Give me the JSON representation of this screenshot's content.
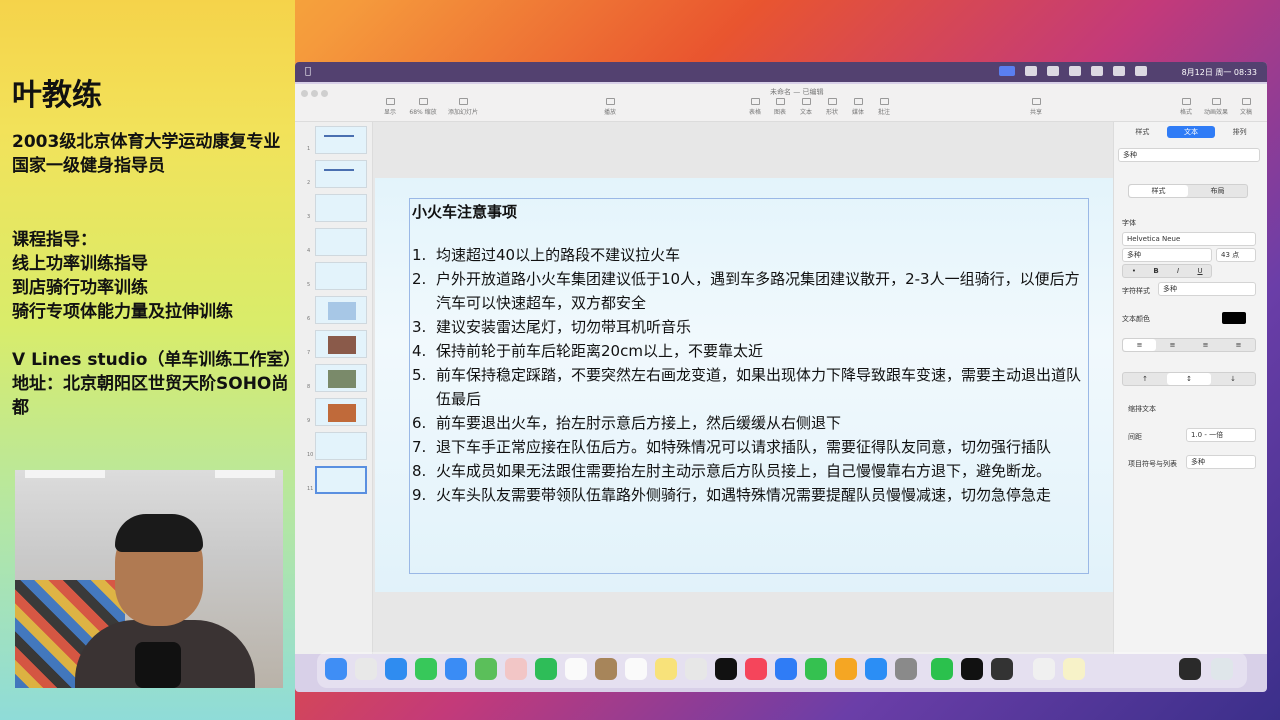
{
  "presenter": {
    "name": "叶教练",
    "bio_lines_1": [
      "2003级北京体育大学运动康复专业",
      "国家一级健身指导员"
    ],
    "bio_lines_2": [
      "课程指导：",
      "线上功率训练指导",
      "到店骑行功率训练",
      "骑行专项体能力量及拉伸训练"
    ],
    "bio_lines_3": [
      "V Lines studio（单车训练工作室）",
      "地址：北京朝阳区世贸天阶SOHO尚都"
    ]
  },
  "menubar": {
    "clock": "8月12日 周一 08:33"
  },
  "keynote": {
    "doc_title": "未命名 — 已编辑",
    "toolbar": [
      {
        "name": "view",
        "label": "显示"
      },
      {
        "name": "zoom",
        "label": "68%  缩放"
      },
      {
        "name": "add-slide",
        "label": "添加幻灯片"
      },
      {
        "name": "play",
        "label": "播放"
      },
      {
        "name": "table",
        "label": "表格"
      },
      {
        "name": "chart",
        "label": "图表"
      },
      {
        "name": "text",
        "label": "文本"
      },
      {
        "name": "shape",
        "label": "形状"
      },
      {
        "name": "media",
        "label": "媒体"
      },
      {
        "name": "comment",
        "label": "批注"
      },
      {
        "name": "share",
        "label": "共享"
      },
      {
        "name": "format",
        "label": "格式"
      },
      {
        "name": "animate",
        "label": "动画效果"
      },
      {
        "name": "document",
        "label": "文稿"
      }
    ],
    "slides_count": 11,
    "selected_slide": 11,
    "slide": {
      "heading": "小火车注意事项",
      "items": [
        "均速超过40以上的路段不建议拉火车",
        "户外开放道路小火车集团建议低于10人，遇到车多路况集团建议散开，2-3人一组骑行，以便后方汽车可以快速超车，双方都安全",
        "建议安装雷达尾灯，切勿带耳机听音乐",
        "保持前轮于前车后轮距离20cm以上，不要靠太近",
        "前车保持稳定踩踏，不要突然左右画龙变道，如果出现体力下降导致跟车变速，需要主动退出道队伍最后",
        "前车要退出火车，抬左肘示意后方接上，然后缓缓从右侧退下",
        "退下车手正常应接在队伍后方。如特殊情况可以请求插队，需要征得队友同意，切勿强行插队",
        "火车成员如果无法跟住需要抬左肘主动示意后方队员接上，自己慢慢靠右方退下，避免断龙。",
        "火车头队友需要带领队伍靠路外侧骑行，如遇特殊情况需要提醒队员慢慢减速，切勿急停急走"
      ]
    },
    "inspector": {
      "tabs": [
        "样式",
        "文本",
        "排列"
      ],
      "active_tab": "文本",
      "paragraph_style": "多种",
      "seg_tabs": [
        "样式",
        "布局"
      ],
      "font_label": "字体",
      "font_name": "Helvetica Neue",
      "font_style": "多种",
      "font_size": "43 点",
      "char_style_label": "字符样式",
      "char_style_value": "多种",
      "text_color_label": "文本颜色",
      "shrink_text": "缩排文本",
      "spacing_label": "间距",
      "spacing_value": "1.0 - 一倍",
      "bullets_label": "项目符号与列表",
      "bullets_value": "多种"
    }
  }
}
